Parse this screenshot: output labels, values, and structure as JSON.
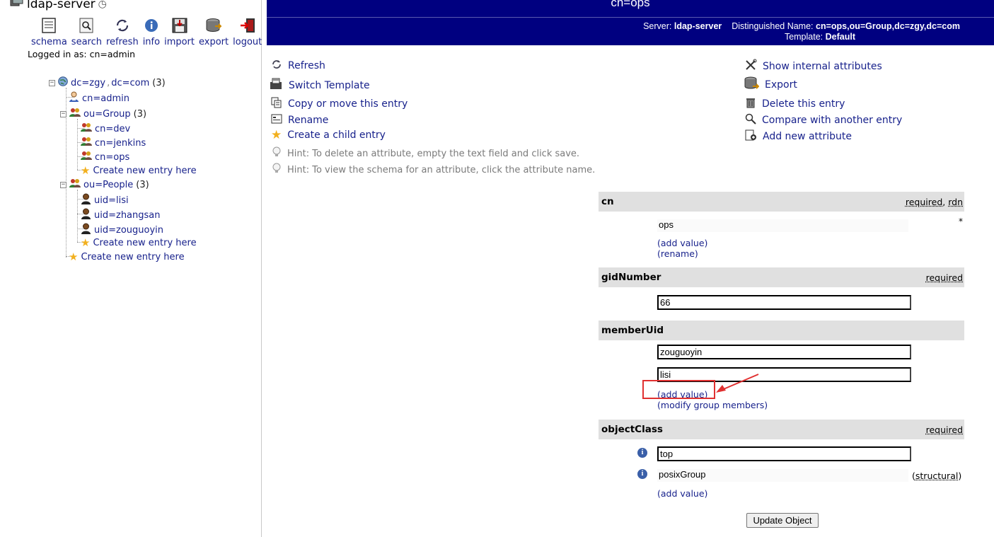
{
  "left": {
    "server_name": "ldap-server",
    "toolbar": [
      {
        "label": "schema",
        "icon": "schema-icon"
      },
      {
        "label": "search",
        "icon": "search-icon"
      },
      {
        "label": "refresh",
        "icon": "refresh-icon"
      },
      {
        "label": "info",
        "icon": "info-icon"
      },
      {
        "label": "import",
        "icon": "import-icon"
      },
      {
        "label": "export",
        "icon": "export-icon"
      },
      {
        "label": "logout",
        "icon": "logout-icon"
      }
    ],
    "logged_in": "Logged in as: cn=admin",
    "tree": {
      "root": {
        "pre": "dc=zgy",
        "sep": ",",
        "post": "dc=com",
        "count": "(3)"
      },
      "admin": "cn=admin",
      "group": {
        "label": "ou=Group",
        "count": "(3)"
      },
      "group_children": [
        "cn=dev",
        "cn=jenkins",
        "cn=ops"
      ],
      "people": {
        "label": "ou=People",
        "count": "(3)"
      },
      "people_children": [
        "uid=lisi",
        "uid=zhangsan",
        "uid=zouguoyin"
      ],
      "create_new": "Create new entry here"
    }
  },
  "header": {
    "title": "cn=ops",
    "server_label": "Server:",
    "server_value": "ldap-server",
    "dn_label": "Distinguished Name:",
    "dn_value": "cn=ops,ou=Group,dc=zgy,dc=com",
    "template_label": "Template:",
    "template_value": "Default"
  },
  "actions_left": [
    {
      "label": "Refresh",
      "icon": "refresh-icon"
    },
    {
      "label": "Switch Template",
      "icon": "switch-template-icon"
    },
    {
      "label": "Copy or move this entry",
      "icon": "copy-icon"
    },
    {
      "label": "Rename",
      "icon": "rename-icon"
    },
    {
      "label": "Create a child entry",
      "icon": "star-icon"
    }
  ],
  "actions_right": [
    {
      "label": "Show internal attributes",
      "icon": "tools-icon"
    },
    {
      "label": "Export",
      "icon": "export-icon"
    },
    {
      "label": "Delete this entry",
      "icon": "trash-icon"
    },
    {
      "label": "Compare with another entry",
      "icon": "compare-icon"
    },
    {
      "label": "Add new attribute",
      "icon": "add-attribute-icon"
    }
  ],
  "hints": [
    "Hint: To delete an attribute, empty the text field and click save.",
    "Hint: To view the schema for an attribute, click the attribute name."
  ],
  "attributes": {
    "cn": {
      "name": "cn",
      "flag1": "required",
      "sep": ",",
      "flag2": "rdn",
      "value": "ops",
      "marker": "*",
      "add_value": "add value",
      "rename": "rename"
    },
    "gidNumber": {
      "name": "gidNumber",
      "flag": "required",
      "value": "66"
    },
    "memberUid": {
      "name": "memberUid",
      "values": [
        "zouguoyin",
        "lisi"
      ],
      "add_value": "add value",
      "modify": "modify group members"
    },
    "objectClass": {
      "name": "objectClass",
      "flag": "required",
      "values": [
        "top",
        "posixGroup"
      ],
      "structural": "structural",
      "add_value": "add value"
    }
  },
  "update_button": "Update Object",
  "colors": {
    "header_bg": "#000080",
    "link": "#18228c",
    "annotation": "#e03030"
  }
}
